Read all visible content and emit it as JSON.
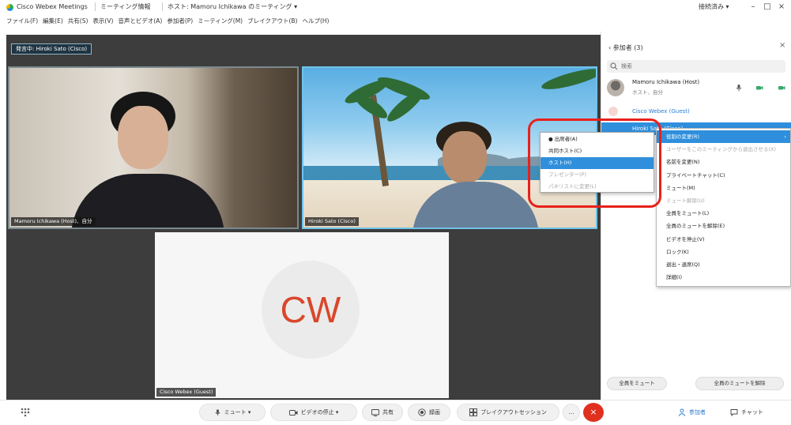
{
  "window": {
    "app_title": "Cisco Webex Meetings",
    "meeting_info": "ミーティング情報",
    "host_info": "ホスト: Mamoru Ichikawa のミーティング ▾",
    "connection_status": "接続済み ▾",
    "minimize": "–",
    "maximize": "□",
    "close": "×"
  },
  "menu": {
    "items": [
      "ファイル(F)",
      "編集(E)",
      "共有(S)",
      "表示(V)",
      "音声とビデオ(A)",
      "参加者(P)",
      "ミーティング(M)",
      "ブレイクアウト(B)",
      "ヘルプ(H)"
    ]
  },
  "stage": {
    "active_speaker_label": "発言中: Hiroki Sato (Cisco)",
    "tiles": [
      {
        "name": "Mamoru Ichikawa (Host)、自分"
      },
      {
        "name": "Hiroki Sato (Cisco)"
      },
      {
        "name": "Cisco Webex (Guest)",
        "initials": "CW"
      }
    ]
  },
  "participants_panel": {
    "title": "‹  参加者 (3)",
    "close": "×",
    "search_placeholder": "検索",
    "participants": [
      {
        "name": "Mamoru Ichikawa (Host)",
        "detail": "ホスト、自分"
      },
      {
        "name": "Cisco Webex (Guest)"
      },
      {
        "name": "Hiroki Sato (Cisco)"
      }
    ],
    "mute_all": "全員をミュート",
    "unmute_all": "全員のミュートを解除"
  },
  "context_menu": {
    "items": [
      {
        "label": "役割の変更(R)",
        "arrow": "›",
        "highlighted": true
      },
      {
        "label": "ユーザーをこのミーティングから退出させる(X)",
        "disabled": true
      },
      {
        "label": "名前を変更(N)"
      },
      {
        "label": "プライベートチャット(C)"
      },
      {
        "label": "ミュート(M)"
      },
      {
        "label": "ミュート解除(U)",
        "disabled": true
      },
      {
        "label": "全員をミュート(L)"
      },
      {
        "label": "全員のミュートを解除(E)"
      },
      {
        "label": "ビデオを停止(V)"
      },
      {
        "label": "ロック(K)"
      },
      {
        "label": "退出・退席(Q)"
      },
      {
        "label": "詳細(I)"
      }
    ]
  },
  "role_submenu": {
    "items": [
      {
        "label": "● 出席者(A)"
      },
      {
        "label": "共同ホスト(C)"
      },
      {
        "label": "ホスト(H)",
        "highlighted": true
      },
      {
        "label": "プレゼンター(P)",
        "disabled": true
      },
      {
        "label": "パネリストに変更(L)",
        "disabled": true
      }
    ]
  },
  "toolbar": {
    "mute": "ミュート ▾",
    "video": "ビデオの停止 ▾",
    "share": "共有",
    "record": "録画",
    "breakout": "ブレイクアウトセッション",
    "more": "…",
    "end": "×",
    "participants": "参加者",
    "chat": "チャット"
  },
  "colors": {
    "accent": "#2f8fdc",
    "end_call": "#e0311f",
    "annotation": "#e8201a",
    "initials": "#d9472b",
    "active_speaker_border": "#6fc3ea"
  },
  "icons": {
    "dial": "dial-pad-icon",
    "search": "search-icon",
    "mic": "microphone-icon",
    "video": "video-camera-icon",
    "share": "share-screen-icon",
    "record": "record-icon",
    "breakout": "breakout-icon",
    "participants": "participants-icon",
    "chat": "chat-icon"
  }
}
